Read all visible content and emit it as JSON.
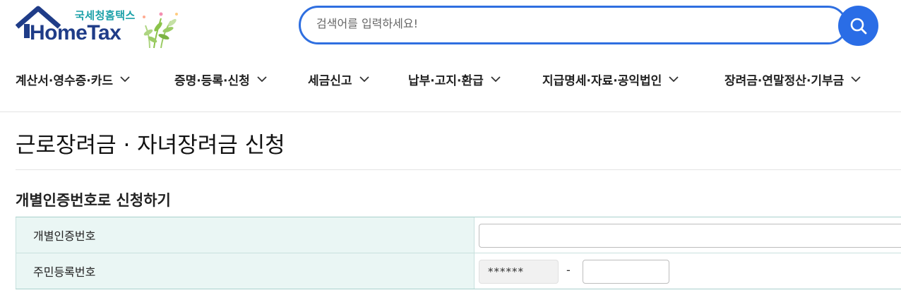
{
  "header": {
    "logo_subtitle": "국세청홈택스",
    "logo_brand": "HomeTax",
    "search_placeholder": "검색어를 입력하세요!",
    "colors": {
      "brand": "#1f3c88",
      "accent": "#2a6de6",
      "teal": "#1aa0a8"
    }
  },
  "nav": {
    "items": [
      {
        "label": "계산서·영수증·카드",
        "icon": "chevron-down-icon"
      },
      {
        "label": "증명·등록·신청",
        "icon": "chevron-down-icon"
      },
      {
        "label": "세금신고",
        "icon": "chevron-down-icon"
      },
      {
        "label": "납부·고지·환급",
        "icon": "chevron-down-icon"
      },
      {
        "label": "지급명세·자료·공익법인",
        "icon": "chevron-down-icon"
      },
      {
        "label": "장려금·연말정산·기부금",
        "icon": "chevron-down-icon"
      }
    ]
  },
  "page": {
    "title": "근로장려금 · 자녀장려금 신청",
    "section_title": "개별인증번호로 신청하기"
  },
  "form": {
    "rows": [
      {
        "label": "개별인증번호",
        "value": ""
      },
      {
        "label": "주민등록번호",
        "masked_front": "******",
        "separator": "-",
        "back_value": ""
      }
    ]
  }
}
